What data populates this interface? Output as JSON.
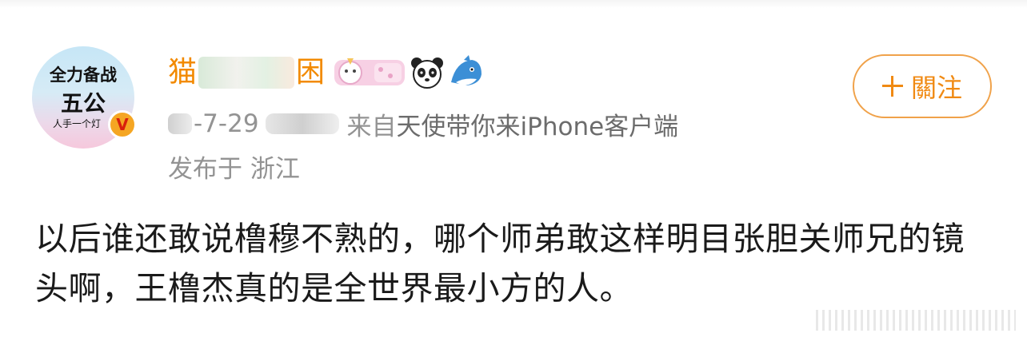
{
  "avatar": {
    "line1": "全力备战",
    "line2": "五公",
    "line3": "人手一个灯",
    "badge": "V",
    "colors": {
      "badge_bg": "#f5a623",
      "badge_fg": "#d8200c"
    }
  },
  "user": {
    "name_start": "猫",
    "name_end": "困",
    "name_color": "#f28a00",
    "emoji_icons": [
      "unicorn-sticker-icon",
      "panda-icon",
      "shark-icon"
    ]
  },
  "meta": {
    "date_visible": "-7-29",
    "source_prefix": "来自",
    "source_app": "天使带你来iPhone客户端",
    "location": "发布于 浙江"
  },
  "follow_button": {
    "label": "關注",
    "icon": "plus-icon",
    "color": "#f08a13"
  },
  "post": {
    "text": "以后谁还敢说橹穆不熟的，哪个师弟敢这样明目张胆关师兄的镜头啊，王橹杰真的是全世界最小方的人。"
  }
}
